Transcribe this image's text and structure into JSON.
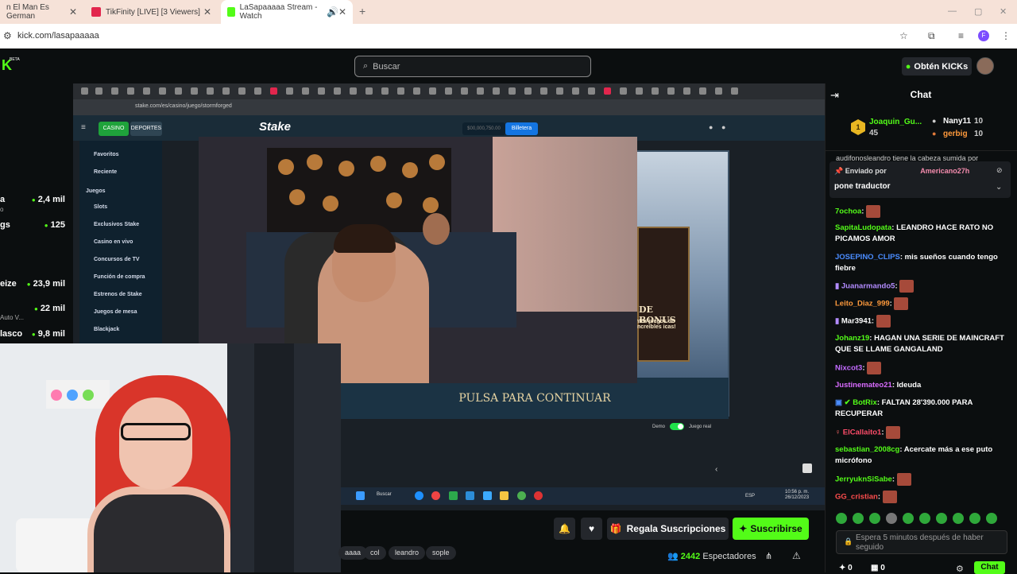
{
  "browser": {
    "tabs": [
      {
        "title": "n El Man Es German",
        "favicon_color": "#888888"
      },
      {
        "title": "TikFinity [LIVE] [3 Viewers]",
        "favicon_color": "#e2264d"
      },
      {
        "title": "LaSapaaaaa Stream - Watch",
        "favicon_color": "#53fc18"
      }
    ],
    "url": "kick.com/lasapaaaaa"
  },
  "header": {
    "search_placeholder": "Buscar",
    "get_kicks_label": "Obtén KICKs",
    "logo_badge": "BETA"
  },
  "sidebar": {
    "channels": [
      {
        "name": "",
        "sub": "",
        "viewers": ""
      },
      {
        "name": "a",
        "sub": "o",
        "viewers": "2,4 mil"
      },
      {
        "name": "gs",
        "sub": "",
        "viewers": "125"
      },
      {
        "name": "eize",
        "sub": "",
        "viewers": "23,9 mil"
      },
      {
        "name": "",
        "sub": "Auto V...",
        "viewers": "22 mil"
      },
      {
        "name": "lasco",
        "sub": "",
        "viewers": "9,8 mil"
      }
    ]
  },
  "stream": {
    "inner_url": "stake.com/es/casino/juego/stormforged",
    "stake_logo": "Stake",
    "casino_label": "CASINO",
    "sports_label": "DEPORTES",
    "balance": "$00,000,750.00",
    "wallet_label": "Billetera",
    "side_menu": [
      "Favoritos",
      "Reciente",
      "Juegos",
      "Slots",
      "Exclusivos Stake",
      "Casino en vivo",
      "Concursos de TV",
      "Función de compra",
      "Estrenos de Stake",
      "Juegos de mesa",
      "Blackjack"
    ],
    "bonus_title": "DE BONUS",
    "bonus_sub": "ntes juegos de increíbles icas!",
    "continue_text": "PULSA PARA CONTINUAR",
    "demo_label": "Demo",
    "real_label": "Juego real",
    "taskbar_search": "Buscar",
    "taskbar_lang": "ESP",
    "taskbar_time": "10:56 p. m.",
    "taskbar_date": "26/12/2023"
  },
  "actions": {
    "gift_label": "Regala Suscripciones",
    "subscribe_label": "Suscribirse",
    "tags": [
      "aaaa",
      "col",
      "leandro",
      "sople"
    ],
    "viewers_count": "2442",
    "viewers_label": "Espectadores"
  },
  "chat": {
    "title": "Chat",
    "leaderboard": {
      "first": {
        "name": "Joaquin_Gu...",
        "points": "45"
      },
      "second": {
        "name": "Nany11",
        "points": "10"
      },
      "third": {
        "name": "gerbig",
        "points": "10"
      }
    },
    "partial_line": "audifonosleandro tiene la cabeza sumida por",
    "pinned": {
      "by_label": "Enviado por",
      "user": "Americano27h",
      "message": "pone traductor"
    },
    "messages": [
      {
        "user": "7ochoa",
        "color": "#53fc18",
        "text": "",
        "emote": true
      },
      {
        "user": "SapitaLudopata",
        "color": "#53fc18",
        "text": "LEANDRO HACE RATO NO PICAMOS AMOR",
        "emote": false
      },
      {
        "user": "JOSEPINO_CLIPS",
        "color": "#4a8cff",
        "text": "mis sueños cuando tengo fiebre",
        "emote": false
      },
      {
        "user": "Juanarmando5",
        "color": "#b38cff",
        "text": "",
        "emote": true
      },
      {
        "user": "Leito_Diaz_999",
        "color": "#ff9a3c",
        "text": "",
        "emote": true
      },
      {
        "user": "Mar3941",
        "color": "#ffffff",
        "text": "",
        "emote": true
      },
      {
        "user": "Johanz19",
        "color": "#53fc18",
        "text": "HAGAN UNA SERIE DE MAINCRAFT QUE SE LLAME GANGALAND",
        "emote": false
      },
      {
        "user": "Nixcot3",
        "color": "#c36bff",
        "text": "",
        "emote": true
      },
      {
        "user": "Justinemateo21",
        "color": "#d96bff",
        "text": "Ideuda",
        "emote": false
      },
      {
        "user": "BotRix",
        "color": "#53fc18",
        "text": "FALTAN 28'390.000 PARA RECUPERAR",
        "emote": false
      },
      {
        "user": "ElCallaito1",
        "color": "#ff4d6a",
        "text": "",
        "emote": true
      },
      {
        "user": "sebastian_2008cg",
        "color": "#53fc18",
        "text": "Acercate más a ese puto micrófono",
        "emote": false
      },
      {
        "user": "JerryuknSiSabe",
        "color": "#53fc18",
        "text": "",
        "emote": true
      },
      {
        "user": "GG_cristian",
        "color": "#ff4d4d",
        "text": "",
        "emote": true
      }
    ],
    "input_placeholder": "Espera 5 minutos después de haber seguido",
    "footer_count_1": "0",
    "footer_count_2": "0",
    "send_label": "Chat"
  }
}
